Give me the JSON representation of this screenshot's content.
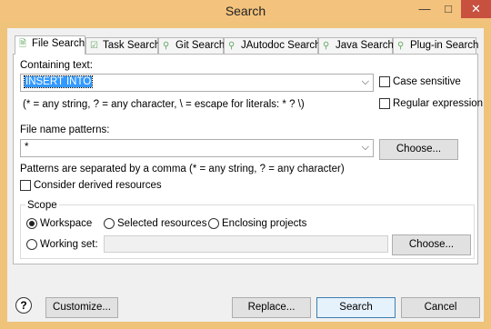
{
  "window": {
    "title": "Search",
    "minimize_glyph": "—",
    "maximize_glyph": "□",
    "close_glyph": "✕"
  },
  "tabs": [
    {
      "label": "File Search",
      "icon": "file-search-icon",
      "active": true
    },
    {
      "label": "Task Search",
      "icon": "task-search-icon"
    },
    {
      "label": "Git Search",
      "icon": "git-search-icon"
    },
    {
      "label": "JAutodoc Search",
      "icon": "jautodoc-search-icon"
    },
    {
      "label": "Java Search",
      "icon": "java-search-icon"
    },
    {
      "label": "Plug-in Search",
      "icon": "plugin-search-icon"
    }
  ],
  "containing": {
    "label": "Containing text:",
    "value": "INSERT INTO",
    "hint": "(* = any string, ? = any character, \\ = escape for literals: * ? \\)",
    "case_sensitive_label": "Case sensitive",
    "regex_label": "Regular expression"
  },
  "patterns": {
    "label": "File name patterns:",
    "value": "*",
    "choose_label": "Choose...",
    "hint": "Patterns are separated by a comma (* = any string, ? = any character)",
    "derived_label": "Consider derived resources"
  },
  "scope": {
    "label": "Scope",
    "workspace": "Workspace",
    "selected": "Selected resources",
    "enclosing": "Enclosing projects",
    "working_set": "Working set:",
    "choose_label": "Choose...",
    "selected_option": "Workspace"
  },
  "footer": {
    "help_glyph": "?",
    "customize": "Customize...",
    "replace": "Replace...",
    "search": "Search",
    "cancel": "Cancel"
  },
  "colors": {
    "titlebar": "#f3c27c",
    "close": "#c7503f",
    "selection": "#3399ff"
  }
}
